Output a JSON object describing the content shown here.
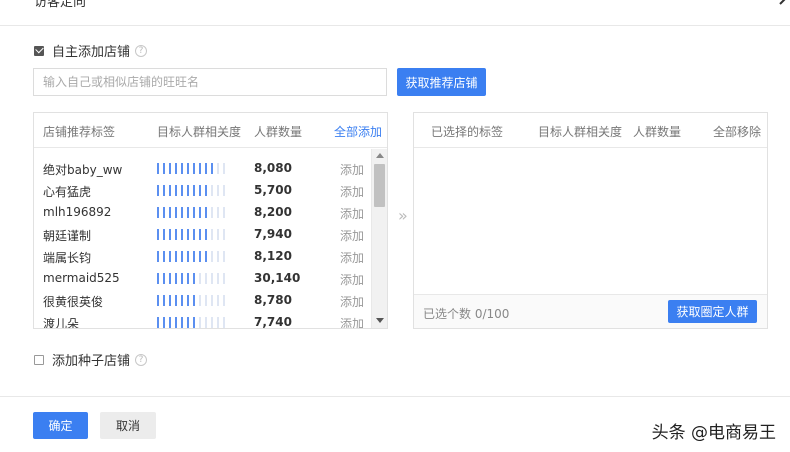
{
  "header": {
    "title": "访客定向"
  },
  "self_add": {
    "label": "自主添加店铺",
    "checked": true
  },
  "search": {
    "placeholder": "输入自己或相似店铺的旺旺名",
    "value": ""
  },
  "fetch_button": {
    "label": "获取推荐店铺"
  },
  "left_panel": {
    "columns": [
      "店铺推荐标签",
      "目标人群相关度",
      "人群数量"
    ],
    "add_all_label": "全部添加",
    "rows": [
      {
        "name": "绝对baby_ww",
        "relevance": 10,
        "count": "8,080",
        "action": "添加"
      },
      {
        "name": "心有猛虎",
        "relevance": 9,
        "count": "5,700",
        "action": "添加"
      },
      {
        "name": "mlh196892",
        "relevance": 9,
        "count": "8,200",
        "action": "添加"
      },
      {
        "name": "朝廷谨制",
        "relevance": 9,
        "count": "7,940",
        "action": "添加"
      },
      {
        "name": "端属长钧",
        "relevance": 9,
        "count": "8,120",
        "action": "添加"
      },
      {
        "name": "mermaid525",
        "relevance": 7,
        "count": "30,140",
        "action": "添加"
      },
      {
        "name": "很黄很英俊",
        "relevance": 7,
        "count": "8,780",
        "action": "添加"
      },
      {
        "name": "渡儿朵",
        "relevance": 7,
        "count": "7,740",
        "action": "添加"
      }
    ],
    "relevance_max": 12
  },
  "right_panel": {
    "columns": [
      "已选择的标签",
      "目标人群相关度",
      "人群数量"
    ],
    "remove_all_label": "全部移除",
    "selected_count": "已选个数 0/100",
    "fixed_button": "获取圈定人群"
  },
  "transfer_arrow": "»",
  "seed_store": {
    "label": "添加种子店铺",
    "checked": false
  },
  "footer": {
    "confirm": "确定",
    "cancel": "取消"
  },
  "watermark": "头条 @电商易王",
  "colors": {
    "primary": "#3b7ff1",
    "bar_on": "#5b8ff0",
    "bar_off": "#dfe6f3"
  }
}
